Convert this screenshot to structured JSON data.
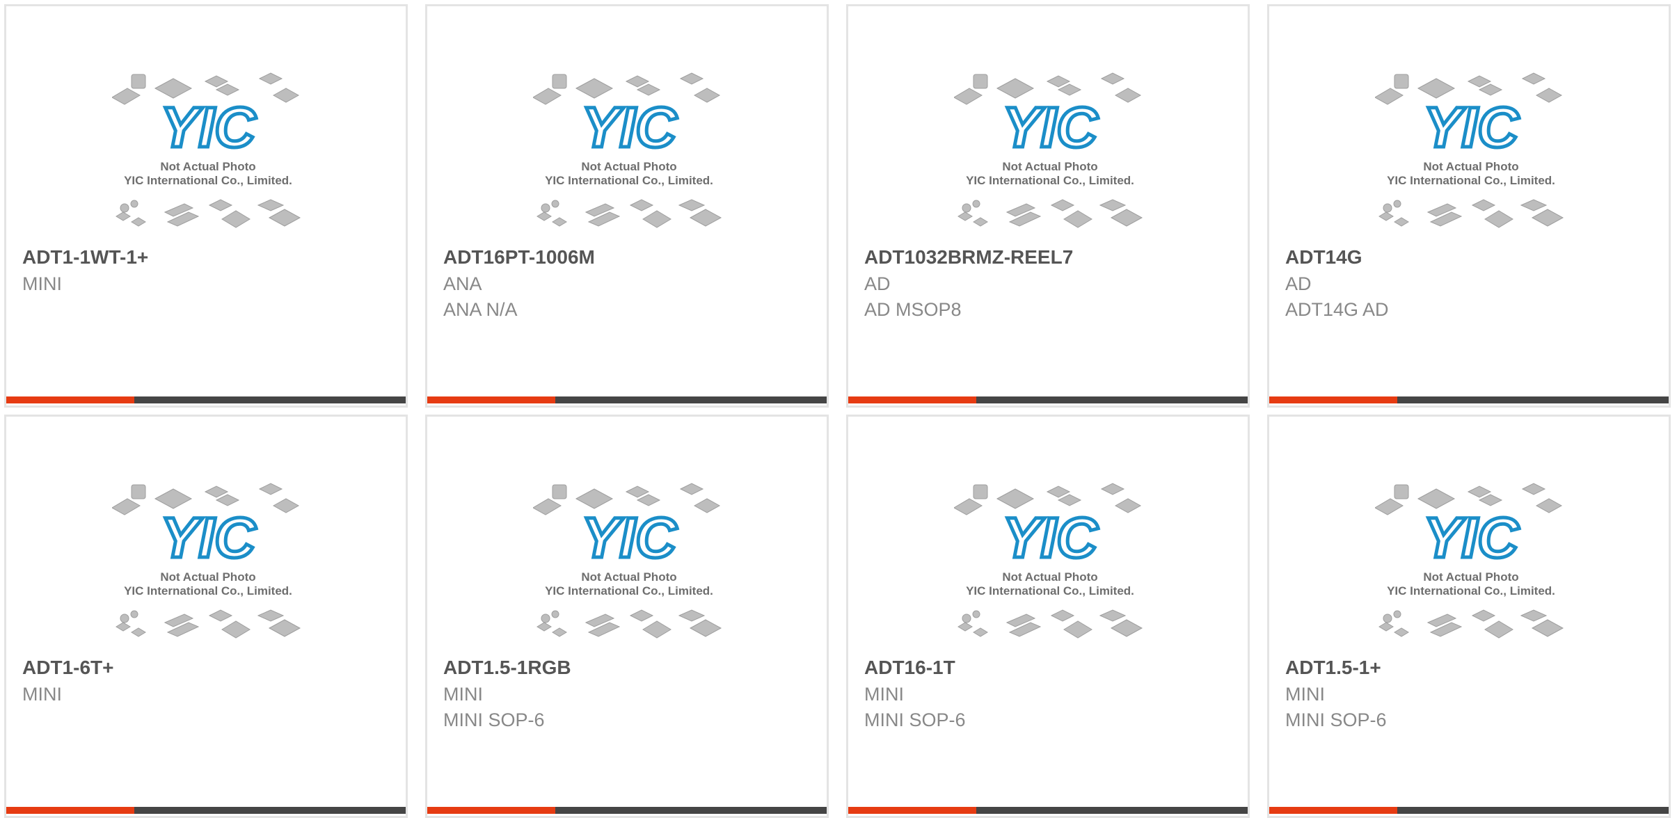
{
  "placeholder_image": {
    "text_line1": "Not Actual Photo",
    "text_line2": "YIC International Co., Limited.",
    "logo_text": "YIC",
    "logo_color": "#1b8ec8"
  },
  "bar_colors": {
    "accent": "#e63b12",
    "track": "#454545"
  },
  "products": [
    {
      "part_number": "ADT1-1WT-1+",
      "line1": "MINI",
      "line2": "",
      "progress": 0.32
    },
    {
      "part_number": "ADT16PT-1006M",
      "line1": "ANA",
      "line2": "ANA N/A",
      "progress": 0.32
    },
    {
      "part_number": "ADT1032BRMZ-REEL7",
      "line1": "AD",
      "line2": "AD MSOP8",
      "progress": 0.32
    },
    {
      "part_number": "ADT14G",
      "line1": "AD",
      "line2": "ADT14G AD",
      "progress": 0.32
    },
    {
      "part_number": "ADT1-6T+",
      "line1": "MINI",
      "line2": "",
      "progress": 0.32
    },
    {
      "part_number": "ADT1.5-1RGB",
      "line1": "MINI",
      "line2": "MINI SOP-6",
      "progress": 0.32
    },
    {
      "part_number": "ADT16-1T",
      "line1": "MINI",
      "line2": "MINI SOP-6",
      "progress": 0.32
    },
    {
      "part_number": "ADT1.5-1+",
      "line1": "MINI",
      "line2": "MINI SOP-6",
      "progress": 0.32
    }
  ]
}
